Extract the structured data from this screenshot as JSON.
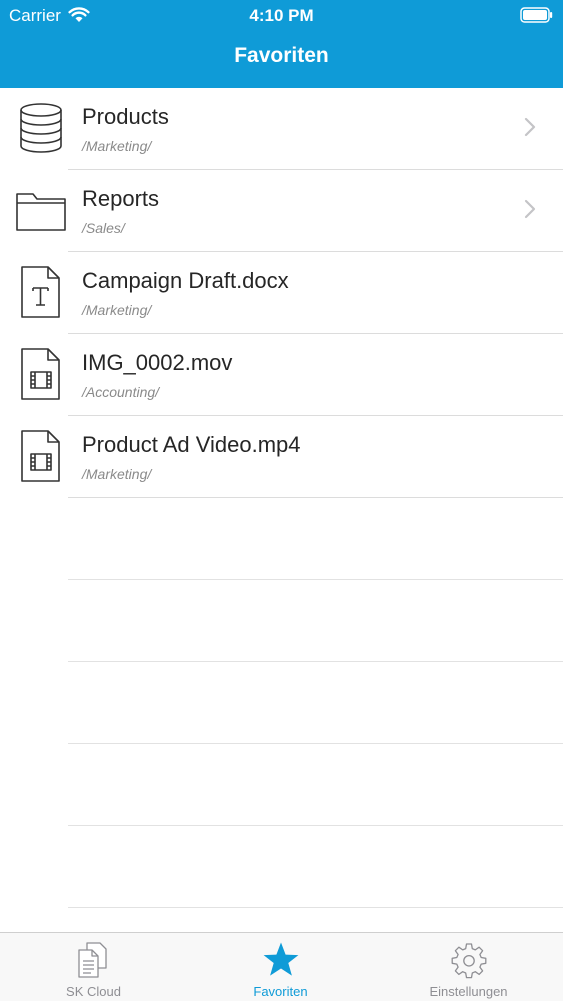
{
  "status_bar": {
    "carrier": "Carrier",
    "time": "4:10 PM"
  },
  "header": {
    "title": "Favoriten"
  },
  "items": [
    {
      "name": "Products",
      "path": "/Marketing/",
      "icon": "database-icon",
      "has_chevron": true
    },
    {
      "name": "Reports",
      "path": "/Sales/",
      "icon": "folder-icon",
      "has_chevron": true
    },
    {
      "name": "Campaign Draft.docx",
      "path": "/Marketing/",
      "icon": "text-document-icon",
      "has_chevron": false
    },
    {
      "name": "IMG_0002.mov",
      "path": "/Accounting/",
      "icon": "video-file-icon",
      "has_chevron": false
    },
    {
      "name": "Product Ad Video.mp4",
      "path": "/Marketing/",
      "icon": "video-file-icon",
      "has_chevron": false
    }
  ],
  "tabbar": {
    "tabs": [
      {
        "label": "SK Cloud",
        "icon": "documents-icon",
        "active": false
      },
      {
        "label": "Favoriten",
        "icon": "star-icon",
        "active": true
      },
      {
        "label": "Einstellungen",
        "icon": "gear-icon",
        "active": false
      }
    ]
  },
  "colors": {
    "accent": "#0f9bd7",
    "separator": "#dcdcdc",
    "subtitle": "#8a8a8a",
    "inactive_tab": "#8e8e93"
  }
}
